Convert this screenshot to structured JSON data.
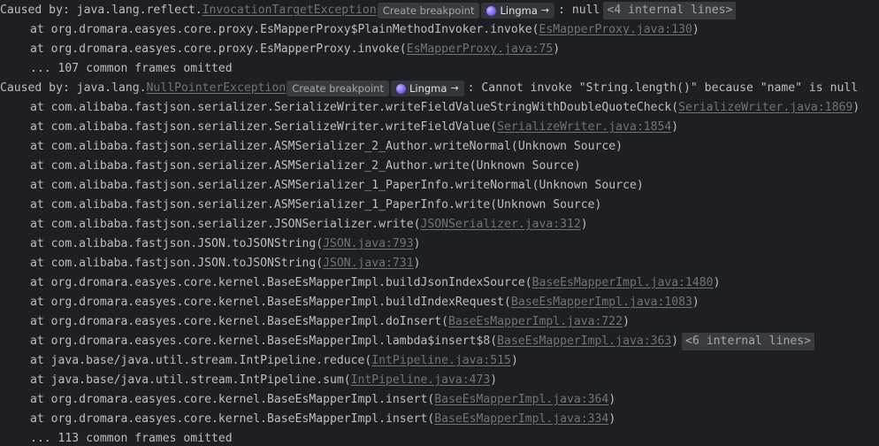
{
  "chips": {
    "create_breakpoint": "Create breakpoint",
    "lingma": "Lingma",
    "lingma_arrow": "→"
  },
  "lines": [
    {
      "caused": "Caused by: java.lang.reflect.",
      "exc": "InvocationTargetException",
      "tail": ": null",
      "fold": "<4 internal lines>"
    },
    {
      "text": "at org.dromara.easyes.core.proxy.EsMapperProxy$PlainMethodInvoker.invoke(",
      "link": "EsMapperProxy.java:130",
      "close": ")"
    },
    {
      "text": "at org.dromara.easyes.core.proxy.EsMapperProxy.invoke(",
      "link": "EsMapperProxy.java:75",
      "close": ")"
    },
    {
      "text": "... 107 common frames omitted"
    },
    {
      "caused": "Caused by: java.lang.",
      "exc": "NullPointerException",
      "tail": ": Cannot invoke \"String.length()\" because \"name\" is null"
    },
    {
      "text": "at com.alibaba.fastjson.serializer.SerializeWriter.writeFieldValueStringWithDoubleQuoteCheck(",
      "link": "SerializeWriter.java:1869",
      "close": ")"
    },
    {
      "text": "at com.alibaba.fastjson.serializer.SerializeWriter.writeFieldValue(",
      "link": "SerializeWriter.java:1854",
      "close": ")"
    },
    {
      "text": "at com.alibaba.fastjson.serializer.ASMSerializer_2_Author.writeNormal(Unknown Source)"
    },
    {
      "text": "at com.alibaba.fastjson.serializer.ASMSerializer_2_Author.write(Unknown Source)"
    },
    {
      "text": "at com.alibaba.fastjson.serializer.ASMSerializer_1_PaperInfo.writeNormal(Unknown Source)"
    },
    {
      "text": "at com.alibaba.fastjson.serializer.ASMSerializer_1_PaperInfo.write(Unknown Source)"
    },
    {
      "text": "at com.alibaba.fastjson.serializer.JSONSerializer.write(",
      "link": "JSONSerializer.java:312",
      "close": ")"
    },
    {
      "text": "at com.alibaba.fastjson.JSON.toJSONString(",
      "link": "JSON.java:793",
      "close": ")"
    },
    {
      "text": "at com.alibaba.fastjson.JSON.toJSONString(",
      "link": "JSON.java:731",
      "close": ")"
    },
    {
      "text": "at org.dromara.easyes.core.kernel.BaseEsMapperImpl.buildJsonIndexSource(",
      "link": "BaseEsMapperImpl.java:1480",
      "close": ")"
    },
    {
      "text": "at org.dromara.easyes.core.kernel.BaseEsMapperImpl.buildIndexRequest(",
      "link": "BaseEsMapperImpl.java:1083",
      "close": ")"
    },
    {
      "text": "at org.dromara.easyes.core.kernel.BaseEsMapperImpl.doInsert(",
      "link": "BaseEsMapperImpl.java:722",
      "close": ")"
    },
    {
      "text": "at org.dromara.easyes.core.kernel.BaseEsMapperImpl.lambda$insert$8(",
      "link": "BaseEsMapperImpl.java:363",
      "close": ")",
      "fold": "<6 internal lines>"
    },
    {
      "text": "at java.base/java.util.stream.IntPipeline.reduce(",
      "link": "IntPipeline.java:515",
      "close": ")"
    },
    {
      "text": "at java.base/java.util.stream.IntPipeline.sum(",
      "link": "IntPipeline.java:473",
      "close": ")"
    },
    {
      "text": "at org.dromara.easyes.core.kernel.BaseEsMapperImpl.insert(",
      "link": "BaseEsMapperImpl.java:364",
      "close": ")"
    },
    {
      "text": "at org.dromara.easyes.core.kernel.BaseEsMapperImpl.insert(",
      "link": "BaseEsMapperImpl.java:334",
      "close": ")"
    },
    {
      "text": "... 113 common frames omitted"
    }
  ]
}
